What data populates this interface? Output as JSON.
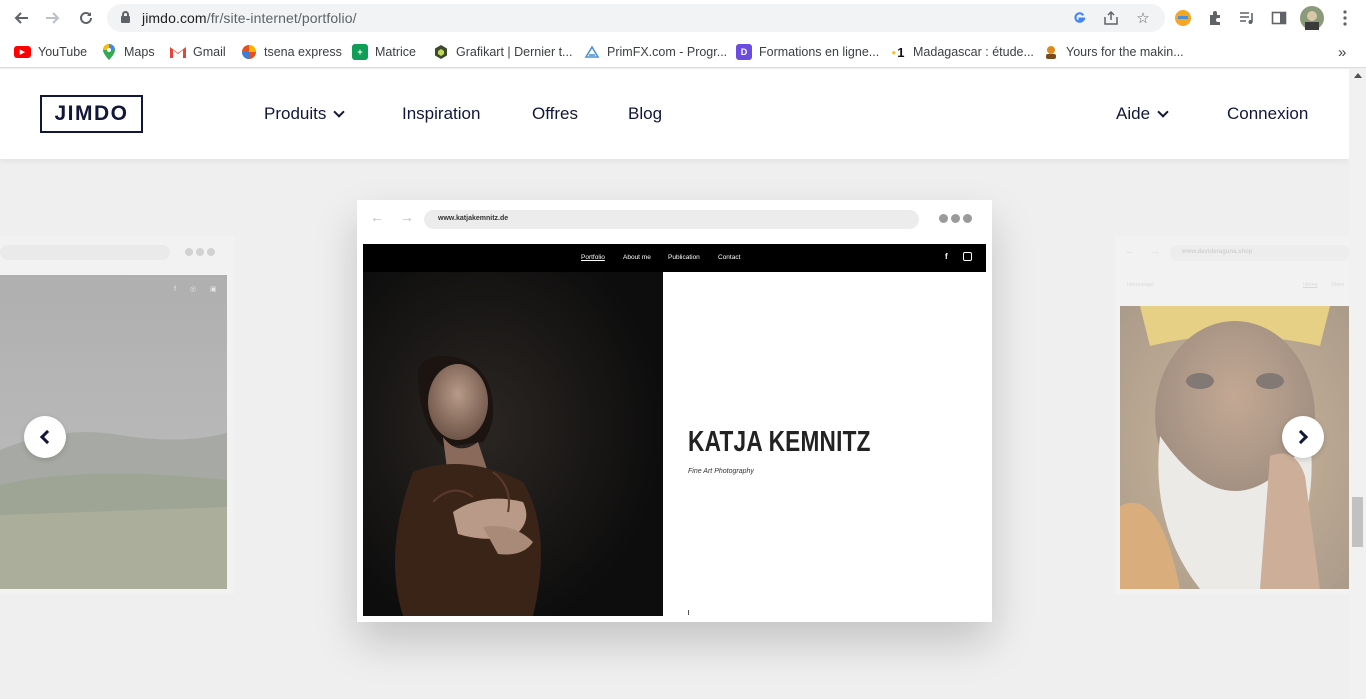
{
  "browser": {
    "url_host": "jimdo.com",
    "url_path": "/fr/site-internet/portfolio/",
    "bookmarks": [
      {
        "label": "YouTube",
        "color": "#ff0000"
      },
      {
        "label": "Maps",
        "color": "#34a853"
      },
      {
        "label": "Gmail",
        "color": "#ea4335"
      },
      {
        "label": "tsena express",
        "color": "#e94e1b"
      },
      {
        "label": "Matrice",
        "color": "#0f9d58"
      },
      {
        "label": "Grafikart | Dernier t...",
        "color": "#556b2f"
      },
      {
        "label": "PrimFX.com - Progr...",
        "color": "#4a90d9"
      },
      {
        "label": "Formations en ligne...",
        "color": "#6c4ce0"
      },
      {
        "label": "Madagascar : étude...",
        "color": "#111111"
      },
      {
        "label": "Yours for the makin...",
        "color": "#e08a1e"
      }
    ],
    "bookmark_overflow": "»"
  },
  "header": {
    "logo": "JIMDO",
    "menu": {
      "produits": "Produits",
      "inspiration": "Inspiration",
      "offres": "Offres",
      "blog": "Blog",
      "aide": "Aide",
      "connexion": "Connexion"
    }
  },
  "showcase": {
    "main": {
      "url": "www.katjakemnitz.de",
      "nav": [
        "Portfolio",
        "About me",
        "Publication",
        "Contact"
      ],
      "name": "KATJA KEMNITZ",
      "subtitle": "Fine Art Photography"
    },
    "right": {
      "url": "www.davideraguna.shop",
      "nav": [
        "Homepage",
        "Home",
        "Store"
      ]
    }
  },
  "colors": {
    "brand": "#12163a",
    "page_bg": "#efefef"
  }
}
